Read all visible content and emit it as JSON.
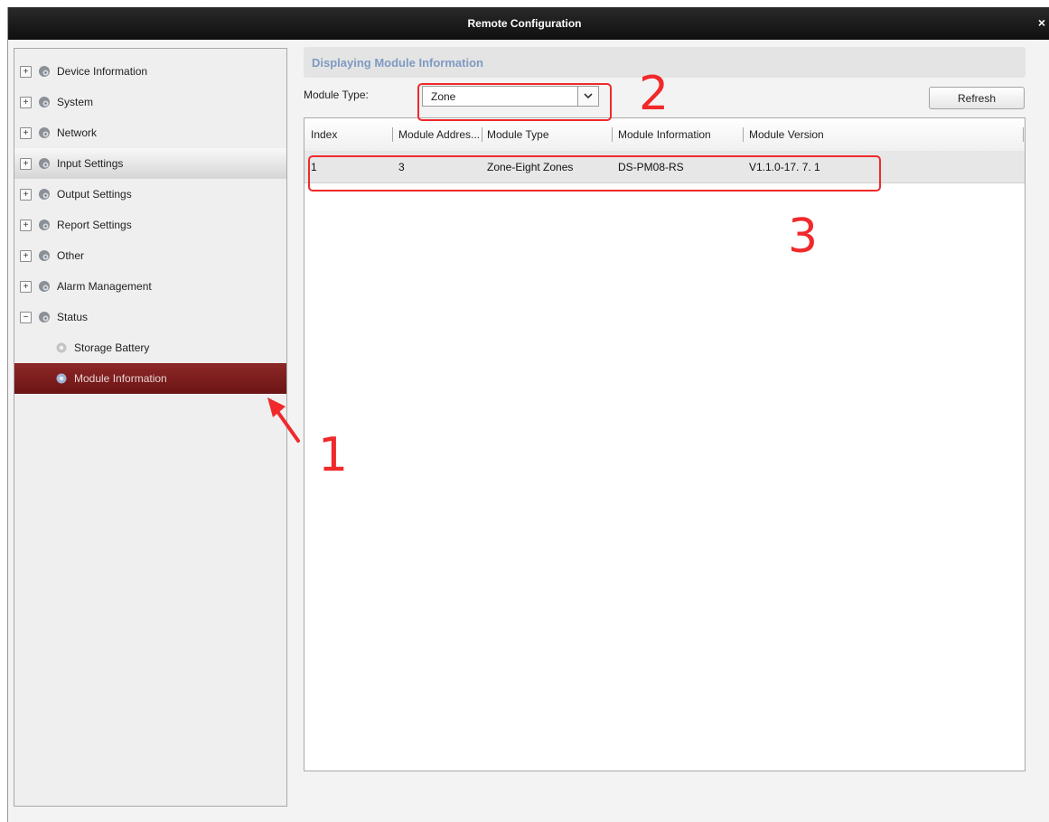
{
  "window": {
    "title": "Remote Configuration",
    "close_glyph": "×"
  },
  "tree": {
    "groups": [
      {
        "label": "Device Information",
        "expander": "+",
        "icon": "gear-icon"
      },
      {
        "label": "System",
        "expander": "+",
        "icon": "gear-icon"
      },
      {
        "label": "Network",
        "expander": "+",
        "icon": "gear-icon"
      },
      {
        "label": "Input Settings",
        "expander": "+",
        "icon": "gear-icon"
      },
      {
        "label": "Output Settings",
        "expander": "+",
        "icon": "gear-icon"
      },
      {
        "label": "Report Settings",
        "expander": "+",
        "icon": "gear-icon"
      },
      {
        "label": "Other",
        "expander": "+",
        "icon": "gear-icon"
      },
      {
        "label": "Alarm Management",
        "expander": "+",
        "icon": "gear-icon"
      },
      {
        "label": "Status",
        "expander": "−",
        "icon": "gear-icon"
      }
    ],
    "children": [
      {
        "label": "Storage Battery",
        "icon": "gear-icon"
      },
      {
        "label": "Module Information",
        "icon": "gear-icon",
        "selected": true
      }
    ]
  },
  "content": {
    "section_title": "Displaying Module Information",
    "module_type_label": "Module Type:",
    "module_type_value": "Zone",
    "refresh_label": "Refresh",
    "table": {
      "columns": [
        "Index",
        "Module Addres...",
        "Module Type",
        "Module Information",
        "Module Version"
      ],
      "rows": [
        [
          "1",
          "3",
          "Zone-Eight Zones",
          "DS-PM08-RS",
          "V1.1.0-17. 7. 1"
        ]
      ]
    }
  },
  "annotations": {
    "n1": "1",
    "n2": "2",
    "n3": "3",
    "color": "#f0292b"
  },
  "colors": {
    "selected_bg": "#7d1e1e",
    "section_title": "#7f9ac2"
  }
}
